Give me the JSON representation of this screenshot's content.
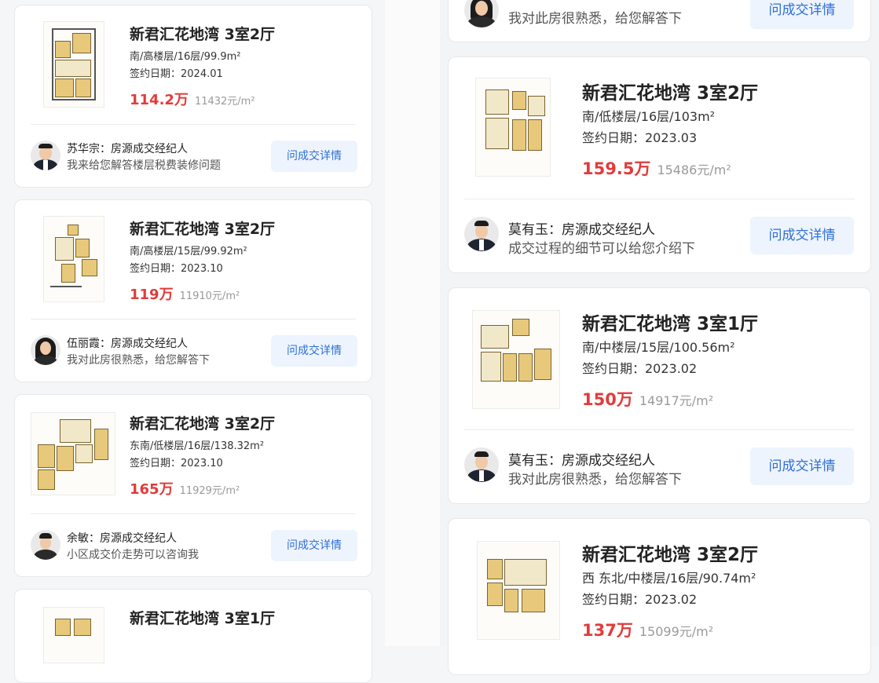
{
  "ask_label": "问成交详情",
  "agent_role": "房源成交经纪人",
  "unit_suffix": "元/m²",
  "left_cards": [
    {
      "title": "新君汇花地湾 3室2厅",
      "meta": "南/高楼层/16层/99.9m²",
      "date": "签约日期：2024.01",
      "price": "114.2万",
      "unit_price": "11432元/m²",
      "agent": "苏华宗：房源成交经纪人",
      "message": "我来给您解答楼层税费装修问题"
    },
    {
      "title": "新君汇花地湾 3室2厅",
      "meta": "南/高楼层/15层/99.92m²",
      "date": "签约日期：2023.10",
      "price": "119万",
      "unit_price": "11910元/m²",
      "agent": "伍丽霞：房源成交经纪人",
      "message": "我对此房很熟悉，给您解答下"
    },
    {
      "title": "新君汇花地湾 3室2厅",
      "meta": "东南/低楼层/16层/138.32m²",
      "date": "签约日期：2023.10",
      "price": "165万",
      "unit_price": "11929元/m²",
      "agent": "余敏：房源成交经纪人",
      "message": "小区成交价走势可以咨询我"
    },
    {
      "title": "新君汇花地湾 3室1厅",
      "meta": "",
      "date": "",
      "price": "",
      "unit_price": "",
      "agent": "",
      "message": ""
    }
  ],
  "right_cards": [
    {
      "title": "",
      "meta": "",
      "date": "",
      "price": "",
      "unit_price": "",
      "agent": "",
      "message": "我对此房很熟悉，给您解答下"
    },
    {
      "title": "新君汇花地湾 3室2厅",
      "meta": "南/低楼层/16层/103m²",
      "date": "签约日期：2023.03",
      "price": "159.5万",
      "unit_price": "15486元/m²",
      "agent": "莫有玉：房源成交经纪人",
      "message": "成交过程的细节可以给您介绍下"
    },
    {
      "title": "新君汇花地湾 3室1厅",
      "meta": "南/中楼层/15层/100.56m²",
      "date": "签约日期：2023.02",
      "price": "150万",
      "unit_price": "14917元/m²",
      "agent": "莫有玉：房源成交经纪人",
      "message": "我对此房很熟悉，给您解答下"
    },
    {
      "title": "新君汇花地湾 3室2厅",
      "meta": "西 东北/中楼层/16层/90.74m²",
      "date": "签约日期：2023.02",
      "price": "137万",
      "unit_price": "15099元/m²",
      "agent": "",
      "message": ""
    }
  ]
}
